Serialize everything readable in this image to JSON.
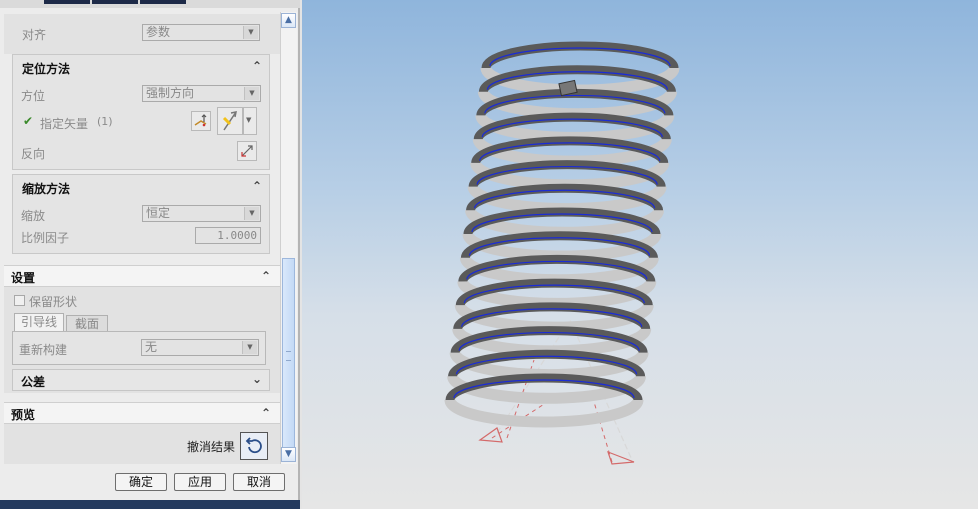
{
  "panel": {
    "align": {
      "label": "对齐",
      "value": "参数"
    },
    "positioning": {
      "title": "定位方法",
      "orientation": {
        "label": "方位",
        "value": "强制方向"
      },
      "vector": {
        "label": "指定矢量",
        "count": "(1)"
      },
      "reverse": {
        "label": "反向"
      }
    },
    "scaling": {
      "title": "缩放方法",
      "scale": {
        "label": "缩放",
        "value": "恒定"
      },
      "factor": {
        "label": "比例因子",
        "value": "1.0000"
      }
    },
    "settings": {
      "title": "设置",
      "preserve_shape": "保留形状",
      "tabs": [
        "引导线",
        "截面"
      ],
      "rebuild": {
        "label": "重新构建",
        "value": "无"
      }
    },
    "tolerance": {
      "title": "公差"
    },
    "preview": {
      "title": "预览",
      "undo_result": "撤消结果"
    },
    "buttons": {
      "ok": "确定",
      "apply": "应用",
      "cancel": "取消"
    }
  },
  "colors": {
    "spring_face": "#c9c9c9",
    "spring_dark": "#5a5a5a",
    "edge_blue": "#1a2bd6",
    "csys_red": "#d46a6a"
  },
  "icons": [
    "scroll-up-icon",
    "scroll-down-icon",
    "check-icon",
    "vector-dialog-icon",
    "vector-type-icon",
    "reverse-direction-icon",
    "undo-icon",
    "collapse-icon",
    "expand-icon"
  ]
}
